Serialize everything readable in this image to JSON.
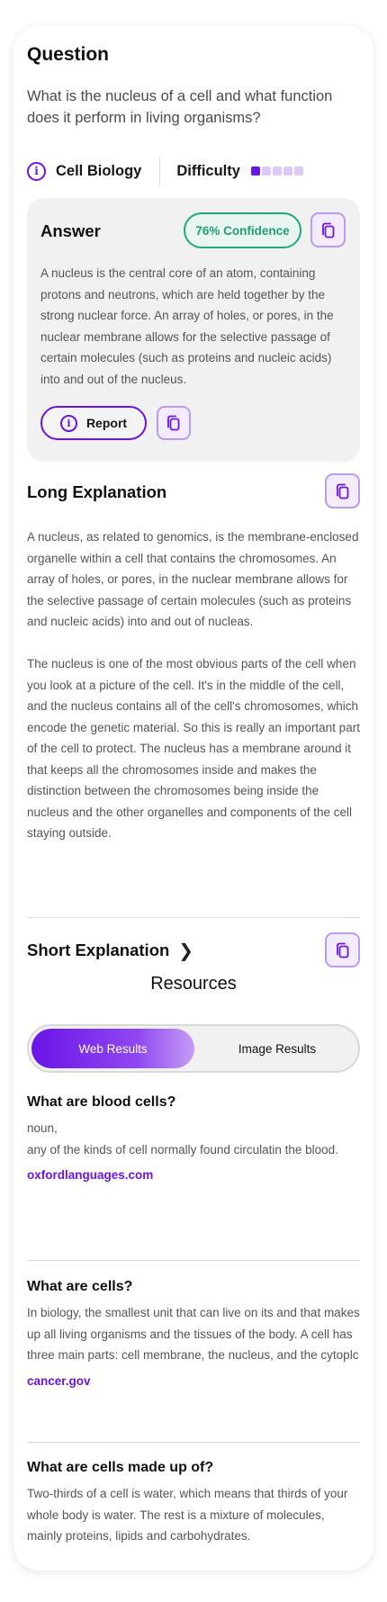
{
  "question": {
    "title": "Question",
    "text": "What is the nucleus of a cell and what function does it perform in living organisms?",
    "subject": "Cell Biology",
    "difficulty_label": "Difficulty",
    "difficulty_level": 1,
    "difficulty_max": 5,
    "info_icon": "info-icon"
  },
  "answer": {
    "title": "Answer",
    "confidence": "76% Confidence",
    "text": "A nucleus is the central core of an atom, containing protons and neutrons, which are held together by the strong nuclear force. An array of holes, or pores, in the nuclear membrane allows for the selective passage of certain molecules (such as proteins and nucleic acids) into and out of the nucleus.",
    "report_label": "Report",
    "copy_icon": "copy-icon"
  },
  "long_explanation": {
    "title": "Long Explanation",
    "paragraphs": [
      "A nucleus, as related to genomics, is the membrane-enclosed organelle within a cell that contains the chromosomes. An array of holes, or pores, in the nuclear membrane allows for the selective passage of certain molecules (such as proteins and nucleic acids) into and out of nucleas.",
      "The nucleus is one of the most obvious parts of the cell when you look at a picture of the cell. It's in the middle of the cell, and the nucleus contains all of the cell's chromosomes, which encode the genetic material. So this is really an important part of the cell to protect. The nucleus has a membrane around it that keeps all the chromosomes inside and makes the distinction between the chromosomes being inside the nucleus and the other organelles and components of the cell staying outside."
    ]
  },
  "short_explanation": {
    "title": "Short Explanation",
    "chevron": "❯"
  },
  "resources": {
    "title": "Resources",
    "tabs": [
      "Web Results",
      "Image Results"
    ],
    "active_tab": "Web Results",
    "items": [
      {
        "title": "What are blood cells?",
        "text": "noun,\nany of the kinds of cell normally found circulatin the blood.",
        "source": "oxfordlanguages.com"
      },
      {
        "title": "What are cells?",
        "text": "In biology, the smallest unit that can live on its and that makes up all living organisms and the tissues of the body. A cell has three main parts: cell membrane, the nucleus, and the cytoplc",
        "source": "cancer.gov"
      },
      {
        "title": "What are cells made up of?",
        "text": "Two-thirds of a cell is water, which means that thirds of your whole body is water. The rest is a mixture of molecules, mainly proteins, lipids and carbohydrates.",
        "source": ""
      }
    ]
  },
  "colors": {
    "accent": "#6a14e6",
    "accent_light": "#ddc8f7",
    "confidence": "#1f9e74",
    "answer_bg": "#f1f1f1"
  }
}
